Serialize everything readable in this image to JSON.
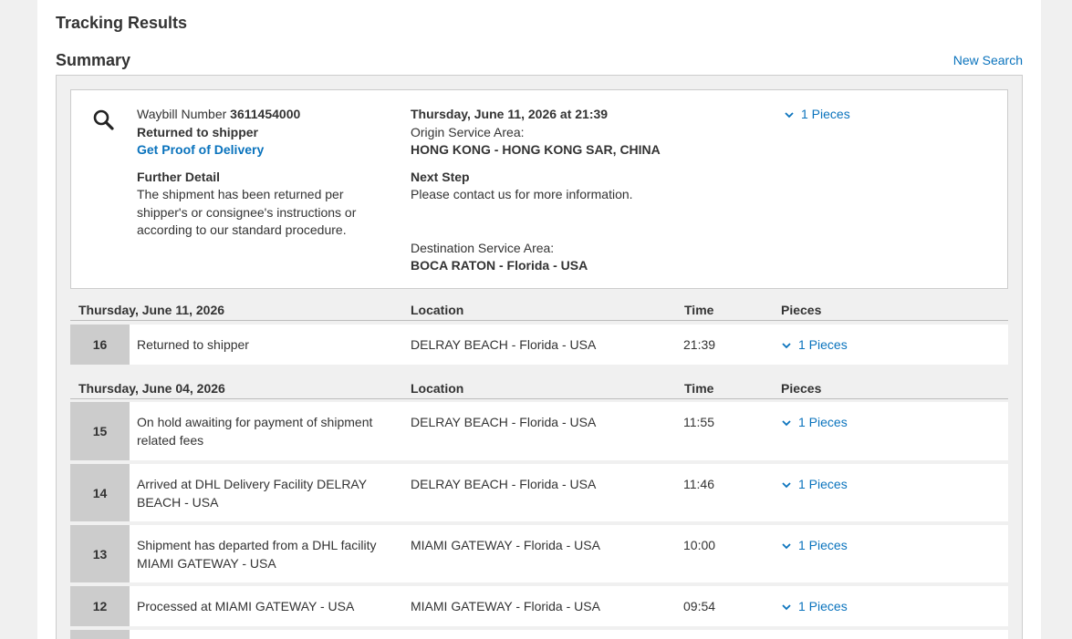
{
  "page": {
    "title": "Tracking Results",
    "summary_title": "Summary",
    "new_search": "New Search"
  },
  "summary": {
    "waybill_label": "Waybill Number",
    "waybill_number": "3611454000",
    "status": "Returned to shipper",
    "proof_link": "Get Proof of Delivery",
    "further_detail_label": "Further Detail",
    "further_detail_text": "The shipment has been returned per shipper's or consignee's instructions or according to our standard procedure.",
    "datetime": "Thursday, June 11, 2026 at 21:39",
    "origin_label": "Origin Service Area:",
    "origin_value": "HONG KONG - HONG KONG SAR, CHINA",
    "next_step_label": "Next Step",
    "next_step_text": "Please contact us for more information.",
    "destination_label": "Destination Service Area:",
    "destination_value": "BOCA RATON - Florida - USA",
    "pieces": "1 Pieces"
  },
  "headers": {
    "location": "Location",
    "time": "Time",
    "pieces": "Pieces"
  },
  "groups": [
    {
      "date": "Thursday, June 11, 2026",
      "events": [
        {
          "num": "16",
          "desc": "Returned to shipper",
          "location": "DELRAY BEACH - Florida - USA",
          "time": "21:39",
          "pieces": "1 Pieces"
        }
      ]
    },
    {
      "date": "Thursday, June 04, 2026",
      "events": [
        {
          "num": "15",
          "desc": "On hold awaiting for payment of shipment related fees",
          "location": "DELRAY BEACH - Florida - USA",
          "time": "11:55",
          "pieces": "1 Pieces"
        },
        {
          "num": "14",
          "desc": "Arrived at DHL Delivery Facility DELRAY BEACH - USA",
          "location": "DELRAY BEACH - Florida - USA",
          "time": "11:46",
          "pieces": "1 Pieces"
        },
        {
          "num": "13",
          "desc": "Shipment has departed from a DHL facility MIAMI GATEWAY - USA",
          "location": "MIAMI GATEWAY - Florida - USA",
          "time": "10:00",
          "pieces": "1 Pieces"
        },
        {
          "num": "12",
          "desc": "Processed at MIAMI GATEWAY - USA",
          "location": "MIAMI GATEWAY - Florida - USA",
          "time": "09:54",
          "pieces": "1 Pieces"
        }
      ]
    }
  ],
  "icons": {
    "search": "search-icon",
    "chevron": "chevron-down-icon"
  },
  "colors": {
    "link": "#0a73bd",
    "number_cell": "#cccccc",
    "background": "#f0f0f0"
  }
}
